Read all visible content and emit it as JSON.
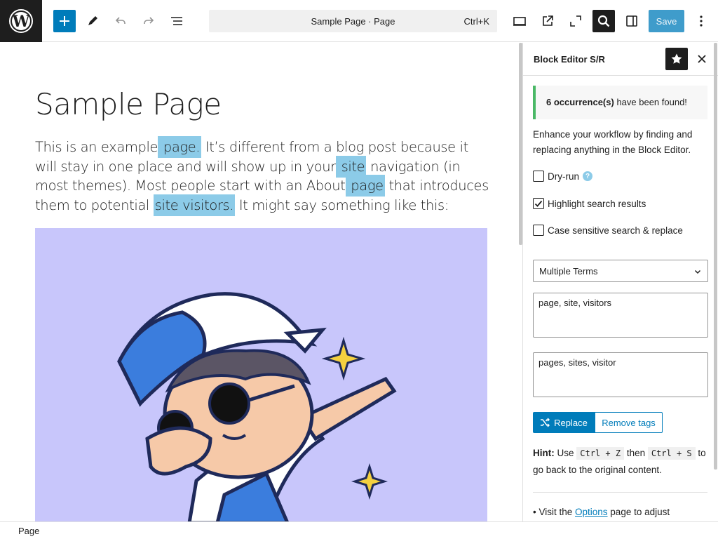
{
  "toolbar": {
    "add_icon": "plus-icon",
    "command_label": "Sample Page · Page",
    "command_shortcut": "Ctrl+K",
    "save_label": "Save"
  },
  "content": {
    "title": "Sample Page",
    "paragraph": [
      {
        "text": "This is an example",
        "hl": false
      },
      {
        "text": " page.",
        "hl": true
      },
      {
        "text": " It’s different from a blog post because it will stay in one place and will show up in your",
        "hl": false
      },
      {
        "text": " site",
        "hl": true
      },
      {
        "text": " navigation (in most themes). Most people start with an About",
        "hl": false
      },
      {
        "text": " page",
        "hl": true
      },
      {
        "text": " that introduces them to potential ",
        "hl": false
      },
      {
        "text": "site visitors.",
        "hl": true
      },
      {
        "text": " It might say something like this:",
        "hl": false
      }
    ],
    "image_bg": "#c8c6fb"
  },
  "sidebar": {
    "title": "Block Editor S/R",
    "notice_count": "6 occurrence(s)",
    "notice_rest": " have been found!",
    "description": "Enhance your workflow by finding and replacing anything in the Block Editor.",
    "dry_run_label": "Dry-run",
    "highlight_label": "Highlight search results",
    "case_label": "Case sensitive search & replace",
    "mode_select": "Multiple Terms",
    "search_terms": "page, site, visitors",
    "replace_terms": "pages, sites, visitor",
    "replace_label": "Replace",
    "remove_tags_label": "Remove tags",
    "hint_label": "Hint:",
    "hint_use": " Use ",
    "hint_key1": "Ctrl + Z",
    "hint_then": " then ",
    "hint_key2": "Ctrl + S",
    "hint_rest": " to go back to the original content.",
    "visit_prefix": "• Visit the ",
    "visit_link": "Options",
    "visit_suffix": " page to adjust"
  },
  "footer": {
    "breadcrumb": "Page"
  },
  "colors": {
    "accent": "#007cba",
    "highlight": "#8ccbe8",
    "success": "#4ab866"
  }
}
